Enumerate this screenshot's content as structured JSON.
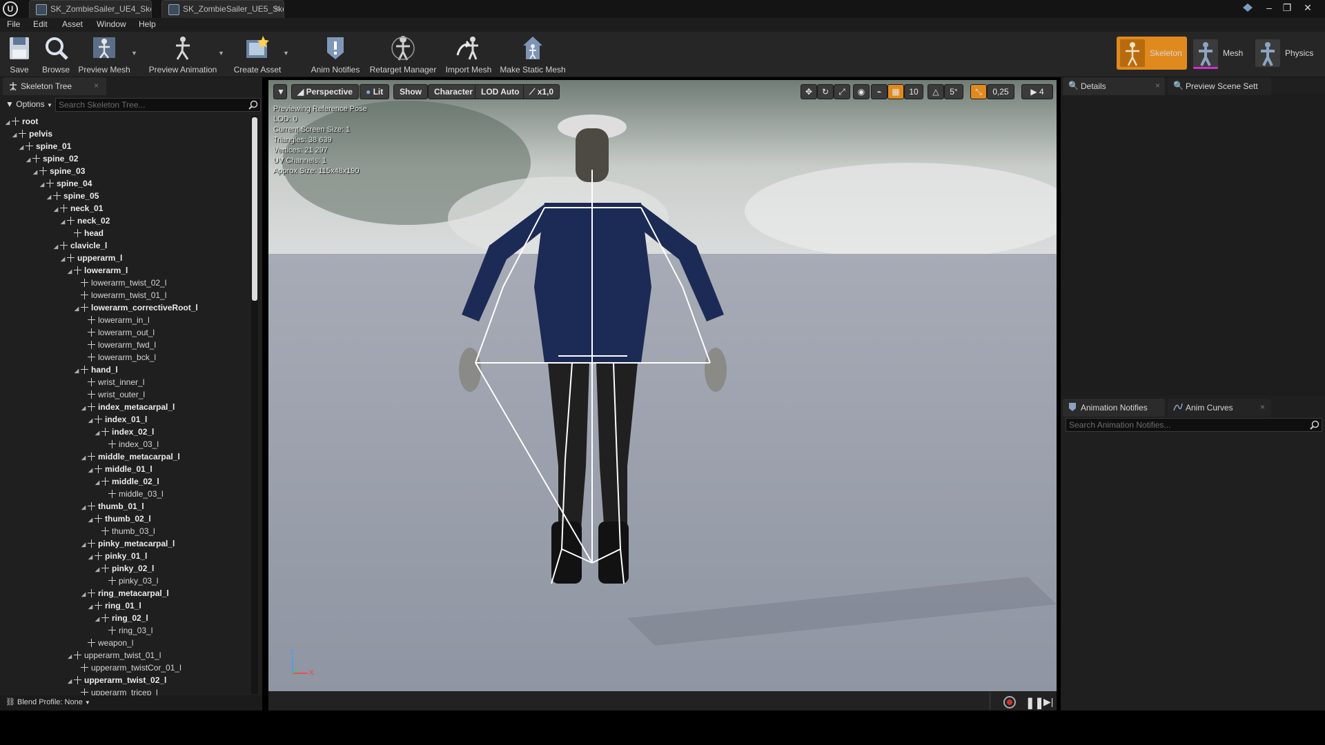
{
  "window": {
    "tabs": [
      {
        "label": "SK_ZombieSailer_UE4_Ske"
      },
      {
        "label": "SK_ZombieSailer_UE5_Ske"
      }
    ],
    "logo": "U"
  },
  "menu": {
    "items": [
      {
        "label": "File"
      },
      {
        "label": "Edit"
      },
      {
        "label": "Asset"
      },
      {
        "label": "Window"
      },
      {
        "label": "Help"
      }
    ]
  },
  "toolbar": {
    "buttons": [
      {
        "label": "Save",
        "icon": "save-icon"
      },
      {
        "label": "Browse",
        "icon": "browse-icon"
      },
      {
        "label": "Preview Mesh",
        "icon": "preview-mesh-icon"
      },
      {
        "label": "Preview Animation",
        "icon": "preview-animation-icon"
      },
      {
        "label": "Create Asset",
        "icon": "create-asset-icon"
      },
      {
        "label": "Anim Notifies",
        "icon": "anim-notifies-icon"
      },
      {
        "label": "Retarget Manager",
        "icon": "retarget-manager-icon"
      },
      {
        "label": "Import Mesh",
        "icon": "import-mesh-icon"
      },
      {
        "label": "Make Static Mesh",
        "icon": "make-static-mesh-icon"
      }
    ],
    "modes": [
      {
        "label": "Skeleton",
        "active": true
      },
      {
        "label": "Mesh",
        "active": false
      },
      {
        "label": "Physics",
        "active": false
      }
    ]
  },
  "skeleton_tree": {
    "tab_label": "Skeleton Tree",
    "options_label": "Options",
    "search_placeholder": "Search Skeleton Tree...",
    "bones": [
      {
        "name": "root",
        "bold": true,
        "expanded": true
      },
      {
        "name": "pelvis",
        "bold": true,
        "expanded": true
      },
      {
        "name": "spine_01",
        "bold": true,
        "expanded": true
      },
      {
        "name": "spine_02",
        "bold": true,
        "expanded": true
      },
      {
        "name": "spine_03",
        "bold": true,
        "expanded": true
      },
      {
        "name": "spine_04",
        "bold": true,
        "expanded": true
      },
      {
        "name": "spine_05",
        "bold": true,
        "expanded": true
      },
      {
        "name": "neck_01",
        "bold": true,
        "expanded": true
      },
      {
        "name": "neck_02",
        "bold": true,
        "expanded": true
      },
      {
        "name": "head",
        "bold": true,
        "expanded": false
      },
      {
        "name": "clavicle_l",
        "bold": true,
        "expanded": true
      },
      {
        "name": "upperarm_l",
        "bold": true,
        "expanded": true
      },
      {
        "name": "lowerarm_l",
        "bold": true,
        "expanded": true
      },
      {
        "name": "lowerarm_twist_02_l",
        "bold": false,
        "expanded": false
      },
      {
        "name": "lowerarm_twist_01_l",
        "bold": false,
        "expanded": false
      },
      {
        "name": "lowerarm_correctiveRoot_l",
        "bold": true,
        "expanded": true
      },
      {
        "name": "lowerarm_in_l",
        "bold": false,
        "expanded": false
      },
      {
        "name": "lowerarm_out_l",
        "bold": false,
        "expanded": false
      },
      {
        "name": "lowerarm_fwd_l",
        "bold": false,
        "expanded": false
      },
      {
        "name": "lowerarm_bck_l",
        "bold": false,
        "expanded": false
      },
      {
        "name": "hand_l",
        "bold": true,
        "expanded": true
      },
      {
        "name": "wrist_inner_l",
        "bold": false,
        "expanded": false
      },
      {
        "name": "wrist_outer_l",
        "bold": false,
        "expanded": false
      },
      {
        "name": "index_metacarpal_l",
        "bold": true,
        "expanded": true
      },
      {
        "name": "index_01_l",
        "bold": true,
        "expanded": true
      },
      {
        "name": "index_02_l",
        "bold": true,
        "expanded": true
      },
      {
        "name": "index_03_l",
        "bold": false,
        "expanded": false
      },
      {
        "name": "middle_metacarpal_l",
        "bold": true,
        "expanded": true
      },
      {
        "name": "middle_01_l",
        "bold": true,
        "expanded": true
      },
      {
        "name": "middle_02_l",
        "bold": true,
        "expanded": true
      },
      {
        "name": "middle_03_l",
        "bold": false,
        "expanded": false
      },
      {
        "name": "thumb_01_l",
        "bold": true,
        "expanded": true
      },
      {
        "name": "thumb_02_l",
        "bold": true,
        "expanded": true
      },
      {
        "name": "thumb_03_l",
        "bold": false,
        "expanded": false
      },
      {
        "name": "pinky_metacarpal_l",
        "bold": true,
        "expanded": true
      },
      {
        "name": "pinky_01_l",
        "bold": true,
        "expanded": true
      },
      {
        "name": "pinky_02_l",
        "bold": true,
        "expanded": true
      },
      {
        "name": "pinky_03_l",
        "bold": false,
        "expanded": false
      },
      {
        "name": "ring_metacarpal_l",
        "bold": true,
        "expanded": true
      },
      {
        "name": "ring_01_l",
        "bold": true,
        "expanded": true
      },
      {
        "name": "ring_02_l",
        "bold": true,
        "expanded": true
      },
      {
        "name": "ring_03_l",
        "bold": false,
        "expanded": false
      },
      {
        "name": "weapon_l",
        "bold": false,
        "expanded": false
      },
      {
        "name": "upperarm_twist_01_l",
        "bold": false,
        "expanded": true
      },
      {
        "name": "upperarm_twistCor_01_l",
        "bold": false,
        "expanded": false
      },
      {
        "name": "upperarm_twist_02_l",
        "bold": true,
        "expanded": true
      },
      {
        "name": "upperarm_tricep_l",
        "bold": false,
        "expanded": false
      }
    ],
    "blend_profile_label": "Blend Profile: None"
  },
  "viewport": {
    "buttons": {
      "perspective": "Perspective",
      "lit": "Lit",
      "show": "Show",
      "character": "Character",
      "lod": "LOD Auto",
      "speed": "x1,0"
    },
    "right_controls": {
      "grid_snap": "10",
      "rotation_snap": "5°",
      "scale_snap": "0,25",
      "camera_speed": "4"
    },
    "stats": [
      "Previewing Reference Pose",
      "LOD: 0",
      "Current Screen Size: 1",
      "Triangles: 38 639",
      "Vertices: 21 297",
      "UV Channels: 1",
      "Approx Size: 115x48x190"
    ],
    "axis": {
      "z": "Z",
      "x": "X"
    }
  },
  "right_panel": {
    "tabs_top": [
      {
        "label": "Details",
        "icon": "details-icon"
      },
      {
        "label": "Preview Scene Sett",
        "icon": "preview-scene-icon"
      }
    ],
    "tabs_bottom": [
      {
        "label": "Animation Notifies",
        "icon": "animation-notifies-icon"
      },
      {
        "label": "Anim Curves",
        "icon": "anim-curves-icon"
      }
    ],
    "notifies_search_placeholder": "Search Animation Notifies..."
  },
  "colors": {
    "accent_orange": "#e08a1e",
    "panel_bg": "#1f1f1f",
    "viewport_floor": "#9aa0ac"
  }
}
